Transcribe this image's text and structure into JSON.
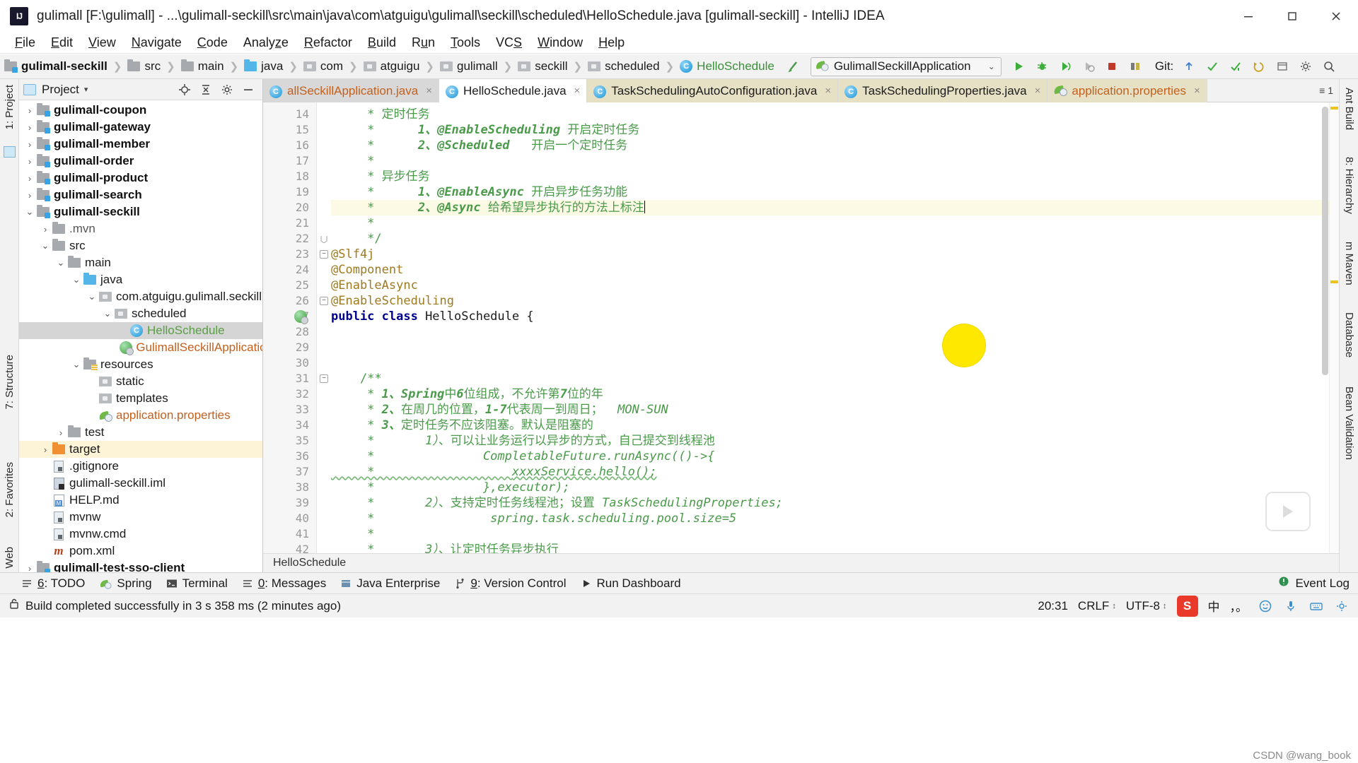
{
  "window": {
    "title": "gulimall [F:\\gulimall] - ...\\gulimall-seckill\\src\\main\\java\\com\\atguigu\\gulimall\\seckill\\scheduled\\HelloSchedule.java [gulimall-seckill] - IntelliJ IDEA",
    "app_logo": "IJ",
    "minimize": "minimize-icon",
    "maximize": "maximize-icon",
    "close": "close-icon"
  },
  "menu": {
    "items": [
      "File",
      "Edit",
      "View",
      "Navigate",
      "Code",
      "Analyze",
      "Refactor",
      "Build",
      "Run",
      "Tools",
      "VCS",
      "Window",
      "Help"
    ]
  },
  "navbar": {
    "crumbs": [
      {
        "label": "gulimall-seckill",
        "icon": "module-folder-icon",
        "kind": "module"
      },
      {
        "label": "src",
        "icon": "folder-icon",
        "kind": "folder"
      },
      {
        "label": "main",
        "icon": "folder-icon",
        "kind": "folder"
      },
      {
        "label": "java",
        "icon": "source-folder-icon",
        "kind": "source"
      },
      {
        "label": "com",
        "icon": "package-icon",
        "kind": "package"
      },
      {
        "label": "atguigu",
        "icon": "package-icon",
        "kind": "package"
      },
      {
        "label": "gulimall",
        "icon": "package-icon",
        "kind": "package"
      },
      {
        "label": "seckill",
        "icon": "package-icon",
        "kind": "package"
      },
      {
        "label": "scheduled",
        "icon": "package-icon",
        "kind": "package"
      },
      {
        "label": "HelloSchedule",
        "icon": "java-class-icon",
        "kind": "class"
      }
    ],
    "run_config": {
      "label": "GulimallSeckillApplication",
      "icon": "spring-boot-icon",
      "caret": "⌄"
    },
    "toolbar_icons": [
      "run-icon",
      "debug-icon",
      "run-with-coverage-icon",
      "profile-icon",
      "stop-icon",
      "build-icon"
    ],
    "git_label": "Git:",
    "git_icons": [
      "update-project-icon",
      "commit-icon",
      "push-icon",
      "rollback-icon",
      "history-icon"
    ],
    "right_icons": [
      "settings-icon",
      "search-everywhere-icon"
    ]
  },
  "left_strips": {
    "top": "1: Project",
    "bottom_items": [
      "2: Favorites",
      "Web"
    ],
    "structure": "7: Structure",
    "todo": "6: TODO"
  },
  "right_strips": {
    "items": [
      "Ant Build",
      "8: Hierarchy",
      "m Maven",
      "Database",
      "Bean Validation"
    ]
  },
  "project_panel": {
    "title": "Project",
    "caret": "▾",
    "actions": [
      "locate-icon",
      "collapse-all-icon",
      "settings-icon",
      "hide-icon"
    ],
    "tree": [
      {
        "label": "gulimall-coupon",
        "depth": 0,
        "arrow": "›",
        "icon": "module-folder-icon",
        "style": "module"
      },
      {
        "label": "gulimall-gateway",
        "depth": 0,
        "arrow": "›",
        "icon": "module-folder-icon",
        "style": "module"
      },
      {
        "label": "gulimall-member",
        "depth": 0,
        "arrow": "›",
        "icon": "module-folder-icon",
        "style": "module"
      },
      {
        "label": "gulimall-order",
        "depth": 0,
        "arrow": "›",
        "icon": "module-folder-icon",
        "style": "module"
      },
      {
        "label": "gulimall-product",
        "depth": 0,
        "arrow": "›",
        "icon": "module-folder-icon",
        "style": "module"
      },
      {
        "label": "gulimall-search",
        "depth": 0,
        "arrow": "›",
        "icon": "module-folder-icon",
        "style": "module"
      },
      {
        "label": "gulimall-seckill",
        "depth": 0,
        "arrow": "⌄",
        "icon": "module-folder-icon",
        "style": "module"
      },
      {
        "label": ".mvn",
        "depth": 1,
        "arrow": "›",
        "icon": "folder-icon",
        "style": "dim"
      },
      {
        "label": "src",
        "depth": 1,
        "arrow": "⌄",
        "icon": "folder-icon",
        "style": "normal"
      },
      {
        "label": "main",
        "depth": 2,
        "arrow": "⌄",
        "icon": "folder-icon",
        "style": "normal"
      },
      {
        "label": "java",
        "depth": 3,
        "arrow": "⌄",
        "icon": "source-folder-icon",
        "style": "normal"
      },
      {
        "label": "com.atguigu.gulimall.seckill",
        "depth": 4,
        "arrow": "⌄",
        "icon": "package-icon",
        "style": "normal"
      },
      {
        "label": "scheduled",
        "depth": 5,
        "arrow": "⌄",
        "icon": "package-icon",
        "style": "normal"
      },
      {
        "label": "HelloSchedule",
        "depth": 6,
        "arrow": "",
        "icon": "java-class-icon",
        "style": "green",
        "selected": true
      },
      {
        "label": "GulimallSeckillApplication",
        "depth": 6,
        "arrow": "",
        "icon": "spring-boot-class-icon",
        "style": "orange"
      },
      {
        "label": "resources",
        "depth": 3,
        "arrow": "⌄",
        "icon": "resources-folder-icon",
        "style": "normal"
      },
      {
        "label": "static",
        "depth": 4,
        "arrow": "",
        "icon": "package-icon",
        "style": "normal"
      },
      {
        "label": "templates",
        "depth": 4,
        "arrow": "",
        "icon": "package-icon",
        "style": "normal"
      },
      {
        "label": "application.properties",
        "depth": 4,
        "arrow": "",
        "icon": "spring-properties-icon",
        "style": "orange"
      },
      {
        "label": "test",
        "depth": 2,
        "arrow": "›",
        "icon": "folder-icon",
        "style": "normal"
      },
      {
        "label": "target",
        "depth": 1,
        "arrow": "›",
        "icon": "target-folder-icon",
        "style": "normal",
        "highlight": true
      },
      {
        "label": ".gitignore",
        "depth": 1,
        "arrow": "",
        "icon": "file-icon",
        "style": "normal"
      },
      {
        "label": "gulimall-seckill.iml",
        "depth": 1,
        "arrow": "",
        "icon": "iml-file-icon",
        "style": "normal"
      },
      {
        "label": "HELP.md",
        "depth": 1,
        "arrow": "",
        "icon": "markdown-file-icon",
        "style": "normal"
      },
      {
        "label": "mvnw",
        "depth": 1,
        "arrow": "",
        "icon": "file-icon",
        "style": "normal"
      },
      {
        "label": "mvnw.cmd",
        "depth": 1,
        "arrow": "",
        "icon": "file-icon",
        "style": "normal"
      },
      {
        "label": "pom.xml",
        "depth": 1,
        "arrow": "",
        "icon": "maven-pom-icon",
        "style": "normal"
      },
      {
        "label": "gulimall-test-sso-client",
        "depth": 0,
        "arrow": "›",
        "icon": "module-folder-icon",
        "style": "module"
      }
    ]
  },
  "editor": {
    "tabs": [
      {
        "label": "allSeckillApplication.java",
        "icon": "java-class-icon",
        "state": "inactive-gray",
        "color": "orange",
        "close": "×"
      },
      {
        "label": "HelloSchedule.java",
        "icon": "java-class-icon",
        "state": "active",
        "color": "black",
        "close": "×"
      },
      {
        "label": "TaskSchedulingAutoConfiguration.java",
        "icon": "java-class-icon",
        "state": "yellowish",
        "color": "black",
        "close": "×"
      },
      {
        "label": "TaskSchedulingProperties.java",
        "icon": "java-class-icon",
        "state": "yellowish",
        "color": "black",
        "close": "×"
      },
      {
        "label": "application.properties",
        "icon": "spring-properties-icon",
        "state": "yellowish",
        "color": "orange",
        "close": "×"
      }
    ],
    "tab_overflow": "≡ 1",
    "breadcrumb": "HelloSchedule",
    "first_line_number": 14,
    "lines": [
      {
        "n": 14,
        "segments": [
          {
            "t": "     * ",
            "c": "cmt"
          },
          {
            "t": "定时任务",
            "c": "cmt"
          }
        ]
      },
      {
        "n": 15,
        "segments": [
          {
            "t": "     *      ",
            "c": "cmt"
          },
          {
            "t": "1、",
            "c": "cmt-b"
          },
          {
            "t": "@EnableScheduling",
            "c": "cmt-b"
          },
          {
            "t": " 开启定时任务",
            "c": "cmt"
          }
        ]
      },
      {
        "n": 16,
        "segments": [
          {
            "t": "     *      ",
            "c": "cmt"
          },
          {
            "t": "2、",
            "c": "cmt-b"
          },
          {
            "t": "@Scheduled",
            "c": "cmt-b"
          },
          {
            "t": "   开启一个定时任务",
            "c": "cmt"
          }
        ]
      },
      {
        "n": 17,
        "segments": [
          {
            "t": "     *",
            "c": "cmt"
          }
        ]
      },
      {
        "n": 18,
        "segments": [
          {
            "t": "     * ",
            "c": "cmt"
          },
          {
            "t": "异步任务",
            "c": "cmt"
          }
        ]
      },
      {
        "n": 19,
        "segments": [
          {
            "t": "     *      ",
            "c": "cmt"
          },
          {
            "t": "1、",
            "c": "cmt-b"
          },
          {
            "t": "@EnableAsync",
            "c": "cmt-b"
          },
          {
            "t": " 开启异步任务功能",
            "c": "cmt"
          }
        ]
      },
      {
        "n": 20,
        "segments": [
          {
            "t": "     *      ",
            "c": "cmt"
          },
          {
            "t": "2、",
            "c": "cmt-b"
          },
          {
            "t": "@Async",
            "c": "cmt-b"
          },
          {
            "t": " 给希望异步执行的方法上标注",
            "c": "cmt"
          }
        ],
        "highlight": true,
        "cursor": true
      },
      {
        "n": 21,
        "segments": [
          {
            "t": "     *",
            "c": "cmt"
          }
        ]
      },
      {
        "n": 22,
        "segments": [
          {
            "t": "     */",
            "c": "cmt"
          }
        ],
        "fold": "end"
      },
      {
        "n": 23,
        "segments": [
          {
            "t": "@Slf4j",
            "c": "ann"
          }
        ],
        "fold": "mark"
      },
      {
        "n": 24,
        "segments": [
          {
            "t": "@Component",
            "c": "ann"
          }
        ]
      },
      {
        "n": 25,
        "segments": [
          {
            "t": "@EnableAsync",
            "c": "ann"
          }
        ]
      },
      {
        "n": 26,
        "segments": [
          {
            "t": "@EnableScheduling",
            "c": "ann"
          }
        ],
        "fold": "mark"
      },
      {
        "n": 27,
        "segments": [
          {
            "t": "public class ",
            "c": "kw"
          },
          {
            "t": "HelloSchedule ",
            "c": "cls"
          },
          {
            "t": "{",
            "c": "cls"
          }
        ],
        "gutter_icon": "spring-bean-icon"
      },
      {
        "n": 28,
        "segments": []
      },
      {
        "n": 29,
        "segments": []
      },
      {
        "n": 30,
        "segments": []
      },
      {
        "n": 31,
        "segments": [
          {
            "t": "    /**",
            "c": "cmt"
          }
        ],
        "fold": "mark"
      },
      {
        "n": 32,
        "segments": [
          {
            "t": "     * ",
            "c": "cmt"
          },
          {
            "t": "1、Spring",
            "c": "cmt-b"
          },
          {
            "t": "中",
            "c": "cmt"
          },
          {
            "t": "6",
            "c": "cmt-b"
          },
          {
            "t": "位组成，不允许第",
            "c": "cmt"
          },
          {
            "t": "7",
            "c": "cmt-b"
          },
          {
            "t": "位的年",
            "c": "cmt"
          }
        ]
      },
      {
        "n": 33,
        "segments": [
          {
            "t": "     * ",
            "c": "cmt"
          },
          {
            "t": "2、",
            "c": "cmt-b"
          },
          {
            "t": "在周几的位置，",
            "c": "cmt"
          },
          {
            "t": "1-7",
            "c": "cmt-b"
          },
          {
            "t": "代表周一到周日；  ",
            "c": "cmt"
          },
          {
            "t": "MON-SUN",
            "c": "cmt-i"
          }
        ]
      },
      {
        "n": 34,
        "segments": [
          {
            "t": "     * ",
            "c": "cmt"
          },
          {
            "t": "3、",
            "c": "cmt-b"
          },
          {
            "t": "定时任务不应该阻塞。默认是阻塞的",
            "c": "cmt"
          }
        ]
      },
      {
        "n": 35,
        "segments": [
          {
            "t": "     *       ",
            "c": "cmt"
          },
          {
            "t": "1）",
            "c": "cmt-i"
          },
          {
            "t": "、可以让业务运行以异步的方式，自己提交到线程池",
            "c": "cmt"
          }
        ]
      },
      {
        "n": 36,
        "segments": [
          {
            "t": "     *               ",
            "c": "cmt"
          },
          {
            "t": "CompletableFuture.runAsync(()->{",
            "c": "cmt-i"
          }
        ]
      },
      {
        "n": 37,
        "segments": [
          {
            "t": "     *                   ",
            "c": "cmt"
          },
          {
            "t": "xxxxService.hello();",
            "c": "cmt-i"
          }
        ],
        "squiggle": true
      },
      {
        "n": 38,
        "segments": [
          {
            "t": "     *               ",
            "c": "cmt"
          },
          {
            "t": "},executor);",
            "c": "cmt-i"
          }
        ]
      },
      {
        "n": 39,
        "segments": [
          {
            "t": "     *       ",
            "c": "cmt"
          },
          {
            "t": "2）",
            "c": "cmt-i"
          },
          {
            "t": "、支持定时任务线程池；设置 ",
            "c": "cmt"
          },
          {
            "t": "TaskSchedulingProperties;",
            "c": "cmt-i"
          }
        ]
      },
      {
        "n": 40,
        "segments": [
          {
            "t": "     *                ",
            "c": "cmt"
          },
          {
            "t": "spring.task.scheduling.pool.size=5",
            "c": "cmt-i"
          }
        ]
      },
      {
        "n": 41,
        "segments": [
          {
            "t": "     *",
            "c": "cmt"
          }
        ]
      },
      {
        "n": 42,
        "segments": [
          {
            "t": "     *       ",
            "c": "cmt"
          },
          {
            "t": "3）",
            "c": "cmt-i"
          },
          {
            "t": "、让定时任务异步执行",
            "c": "cmt"
          }
        ]
      }
    ]
  },
  "bottom_bar": {
    "items": [
      {
        "label": "6: TODO",
        "icon": "todo-icon",
        "underline": "6"
      },
      {
        "label": "Spring",
        "icon": "spring-icon"
      },
      {
        "label": "Terminal",
        "icon": "terminal-icon"
      },
      {
        "label": "0: Messages",
        "icon": "messages-icon",
        "underline": "0"
      },
      {
        "label": "Java Enterprise",
        "icon": "java-ee-icon"
      },
      {
        "label": "9: Version Control",
        "icon": "version-control-icon",
        "underline": "9"
      },
      {
        "label": "Run Dashboard",
        "icon": "run-dashboard-icon"
      }
    ],
    "right": {
      "label": "Event Log",
      "icon": "event-log-icon"
    }
  },
  "status_bar": {
    "message": "Build completed successfully in 3 s 358 ms (2 minutes ago)",
    "caret_position": "20:31",
    "line_separator": "CRLF",
    "encoding": "UTF-8",
    "separator_caret": "↕",
    "ime": {
      "app": "S",
      "mode": "中",
      "punct": "，。",
      "icons": [
        "emoji-icon",
        "mic-icon",
        "keyboard-icon",
        "settings-icon"
      ]
    },
    "lock_icon": "unlocked-icon",
    "watermark": "CSDN @wang_book"
  },
  "colors": {
    "accent_green": "#4a9a4a",
    "annotation": "#9e7a20",
    "keyword": "#00008f",
    "tab_yellow": "#e6e1c4",
    "selection_gray": "#d5d5d5",
    "target_highlight": "#fdf4d7",
    "yellow_marker": "#ffe800",
    "close_red": "#e81123"
  }
}
